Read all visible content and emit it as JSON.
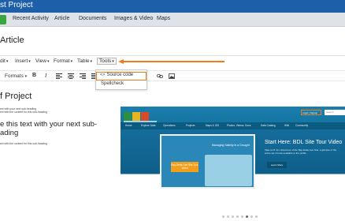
{
  "header": {
    "title": "st Project"
  },
  "tabs": [
    {
      "label": "Recent Activity"
    },
    {
      "label": "Article"
    },
    {
      "label": "Documents"
    },
    {
      "label": "Images & Video"
    },
    {
      "label": "Maps"
    }
  ],
  "page": {
    "heading": "Article"
  },
  "editor": {
    "menus": [
      {
        "label": "dit"
      },
      {
        "label": "Insert"
      },
      {
        "label": "View"
      },
      {
        "label": "Format"
      },
      {
        "label": "Table"
      },
      {
        "label": "Tools"
      }
    ],
    "toolbar": {
      "formats": "Formats",
      "bold": "B",
      "italic": "I"
    },
    "tools_dropdown": [
      {
        "label": "Source code",
        "icon": "code-icon",
        "highlighted": true
      },
      {
        "label": "Spellcheck"
      }
    ],
    "highlight_color": "#f07c19"
  },
  "document": {
    "h1": "f Project",
    "small_1": "ext with your next sub-heading",
    "small_2": "ext with the content for this sub-heading",
    "h2_line1": "e this text with your next sub-",
    "h2_line2": "ading",
    "small_3": "ext with the content for this sub-heading"
  },
  "embedded_site": {
    "login": "Login | Signup",
    "search_placeholder": "Search",
    "nav": [
      "Home",
      "Explore Data",
      "Operations",
      "Projects",
      "Maps & GIS",
      "Photos, Videos, Docs",
      "Data Catalog",
      "Wiki",
      "Community"
    ],
    "panel_title": "Managing Salinity in a Drought",
    "panel_button": "Bay-Delta Live Site Tour Video",
    "tour_title": "Start Here: BDL Site Tour Video",
    "tour_text": "Take an 8 min virtual tour of the Bay-Delta Live Site: a glimpse of the entire set of tools available to the public.",
    "learn_more": "Learn More"
  }
}
